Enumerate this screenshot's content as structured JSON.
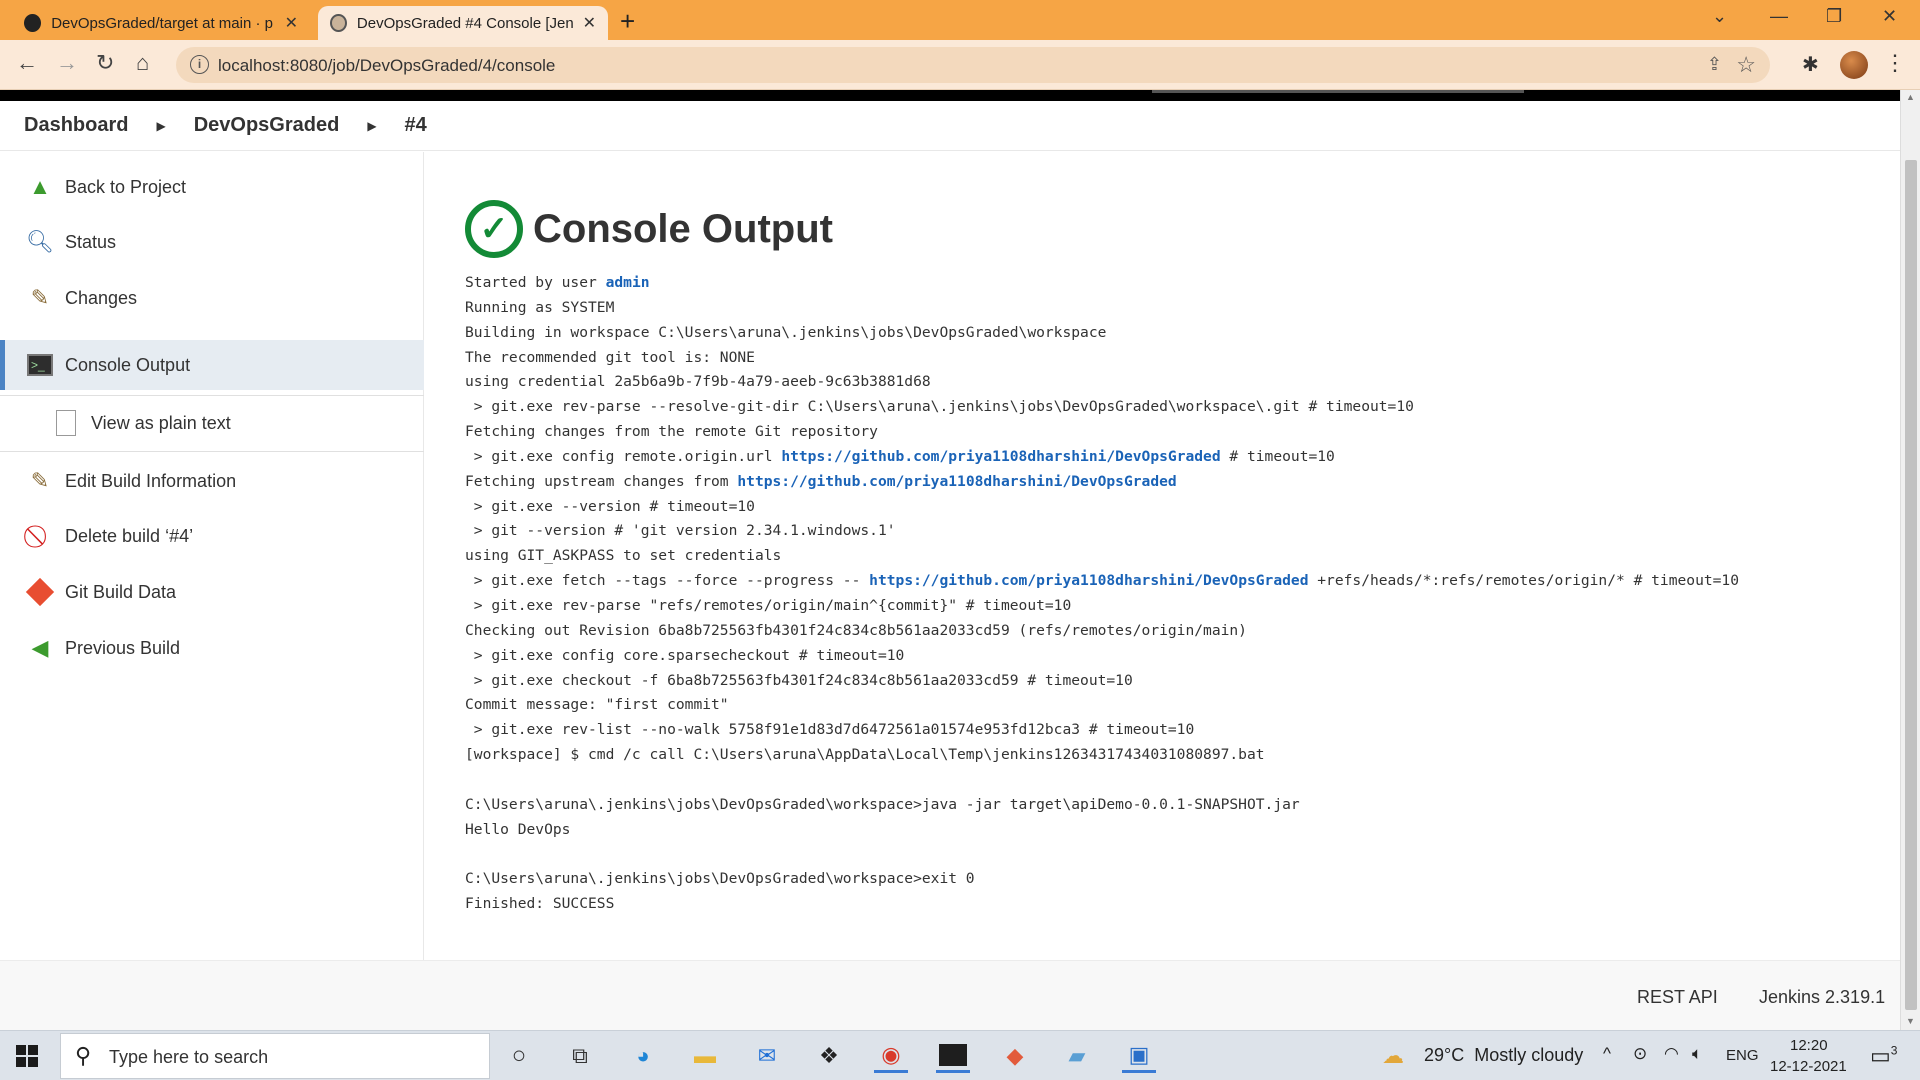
{
  "browser": {
    "tabs": [
      {
        "title": "DevOpsGraded/target at main · p",
        "icon": "github-icon"
      },
      {
        "title": "DevOpsGraded #4 Console [Jenk",
        "icon": "jenkins-icon"
      }
    ],
    "url": "localhost:8080/job/DevOpsGraded/4/console"
  },
  "breadcrumb": [
    "Dashboard",
    "DevOpsGraded",
    "#4"
  ],
  "sidebar": {
    "items": [
      {
        "label": "Back to Project",
        "icon": "up-arrow-icon"
      },
      {
        "label": "Status",
        "icon": "magnifier-icon"
      },
      {
        "label": "Changes",
        "icon": "notepad-icon"
      },
      {
        "label": "Console Output",
        "icon": "terminal-icon"
      },
      {
        "label": "View as plain text",
        "icon": "document-icon"
      },
      {
        "label": "Edit Build Information",
        "icon": "notepad-icon"
      },
      {
        "label": "Delete build ‘#4’",
        "icon": "no-entry-icon"
      },
      {
        "label": "Git Build Data",
        "icon": "git-icon"
      },
      {
        "label": "Previous Build",
        "icon": "left-arrow-icon"
      }
    ]
  },
  "main": {
    "title": "Console Output",
    "status": "success",
    "console": {
      "l1a": "Started by user ",
      "l1link": "admin",
      "l2": "Running as SYSTEM",
      "l3": "Building in workspace C:\\Users\\aruna\\.jenkins\\jobs\\DevOpsGraded\\workspace",
      "l4": "The recommended git tool is: NONE",
      "l5": "using credential 2a5b6a9b-7f9b-4a79-aeeb-9c63b3881d68",
      "l6": " > git.exe rev-parse --resolve-git-dir C:\\Users\\aruna\\.jenkins\\jobs\\DevOpsGraded\\workspace\\.git # timeout=10",
      "l7": "Fetching changes from the remote Git repository",
      "l8a": " > git.exe config remote.origin.url ",
      "l8link": "https://github.com/priya1108dharshini/DevOpsGraded",
      "l8b": " # timeout=10",
      "l9a": "Fetching upstream changes from ",
      "l9link": "https://github.com/priya1108dharshini/DevOpsGraded",
      "l10": " > git.exe --version # timeout=10",
      "l11": " > git --version # 'git version 2.34.1.windows.1'",
      "l12": "using GIT_ASKPASS to set credentials",
      "l13a": " > git.exe fetch --tags --force --progress -- ",
      "l13link": "https://github.com/priya1108dharshini/DevOpsGraded",
      "l13b": " +refs/heads/*:refs/remotes/origin/* # timeout=10",
      "l14": " > git.exe rev-parse \"refs/remotes/origin/main^{commit}\" # timeout=10",
      "l15": "Checking out Revision 6ba8b725563fb4301f24c834c8b561aa2033cd59 (refs/remotes/origin/main)",
      "l16": " > git.exe config core.sparsecheckout # timeout=10",
      "l17": " > git.exe checkout -f 6ba8b725563fb4301f24c834c8b561aa2033cd59 # timeout=10",
      "l18": "Commit message: \"first commit\"",
      "l19": " > git.exe rev-list --no-walk 5758f91e1d83d7d6472561a01574e953fd12bca3 # timeout=10",
      "l20": "[workspace] $ cmd /c call C:\\Users\\aruna\\AppData\\Local\\Temp\\jenkins12634317434031080897.bat",
      "l21": "",
      "l22": "C:\\Users\\aruna\\.jenkins\\jobs\\DevOpsGraded\\workspace>java -jar target\\apiDemo-0.0.1-SNAPSHOT.jar",
      "l23": "Hello DevOps",
      "l24": "",
      "l25": "C:\\Users\\aruna\\.jenkins\\jobs\\DevOpsGraded\\workspace>exit 0",
      "l26": "Finished: SUCCESS"
    }
  },
  "footer": {
    "rest_api": "REST API",
    "version": "Jenkins 2.319.1"
  },
  "taskbar": {
    "search_placeholder": "Type here to search",
    "weather_temp": "29°C",
    "weather_desc": "Mostly cloudy",
    "language": "ENG",
    "time": "12:20",
    "date": "12-12-2021",
    "notifications": "3",
    "pinned": [
      "cortana-icon",
      "task-view-icon",
      "edge-icon",
      "file-explorer-icon",
      "mail-icon",
      "dropbox-icon",
      "chrome-icon",
      "terminal-icon",
      "git-icon",
      "notepad-icon",
      "photos-icon"
    ]
  },
  "colors": {
    "accent": "#f6a545",
    "link": "#1a63b7",
    "success": "#138a36",
    "active_nav": "#e6ecf2"
  }
}
